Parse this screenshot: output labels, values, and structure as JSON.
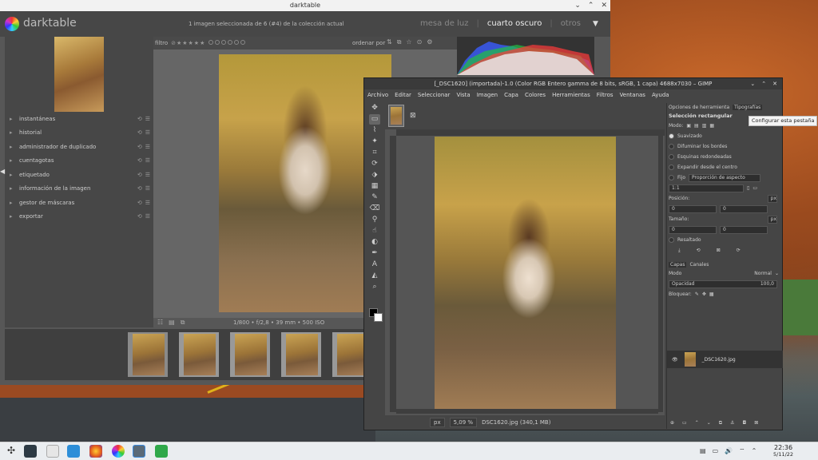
{
  "darktable": {
    "window_title": "darktable",
    "app_name": "darktable",
    "status": "1 imagen seleccionada de 6 (#4) de la colección actual",
    "views": [
      "mesa de luz",
      "cuarto oscuro",
      "otros"
    ],
    "active_view": "cuarto oscuro",
    "filter_label": "filtro",
    "sort_label": "ordenar por",
    "modules": [
      "instantáneas",
      "historial",
      "administrador de duplicado",
      "cuentagotas",
      "etiquetado",
      "información de la imagen",
      "gestor de máscaras",
      "exportar"
    ],
    "image_info": "1/800 • f/2,8 • 39 mm • 500 ISO",
    "filmstrip_count": 5
  },
  "gimp": {
    "window_title": "[_DSC1620] (importada)-1.0 (Color RGB Entero gamma de 8 bits, sRGB, 1 capa) 4688x7030 – GIMP",
    "menu": [
      "Archivo",
      "Editar",
      "Seleccionar",
      "Vista",
      "Imagen",
      "Capa",
      "Colores",
      "Herramientas",
      "Filtros",
      "Ventanas",
      "Ayuda"
    ],
    "dock_tabs": [
      "Opciones de herramienta",
      "Tipografías"
    ],
    "tool_options_title": "Selección rectangular",
    "mode_label": "Modo:",
    "options": [
      "Suavizado",
      "Difuminar los bordes",
      "Esquinas redondeadas",
      "Expandir desde el centro"
    ],
    "fixed_label": "Fijo",
    "fixed_value": "Proporción de aspecto",
    "ratio_value": "1:1",
    "position_label": "Posición:",
    "position_unit": "px",
    "position_x": "0",
    "position_y": "0",
    "size_label": "Tamaño:",
    "size_unit": "px",
    "size_w": "0",
    "size_h": "0",
    "highlight_label": "Resaltado",
    "layers_tabs": [
      "Capas",
      "Canales"
    ],
    "layer_mode_label": "Modo",
    "layer_mode_value": "Normal",
    "opacity_label": "Opacidad",
    "opacity_value": "100,0",
    "lock_label": "Bloquear:",
    "layer_name": "_DSC1620.jpg",
    "status_unit": "px",
    "status_zoom": "5,09 %",
    "status_file": "DSC1620.jpg (340,1 MB)",
    "tooltip": "Configurar esta pestaña"
  },
  "taskbar": {
    "time": "22:36",
    "date": "5/11/22"
  },
  "colors": {
    "dt_bg": "#575757",
    "gimp_bg": "#454545",
    "taskbar_bg": "#eaedf0"
  }
}
